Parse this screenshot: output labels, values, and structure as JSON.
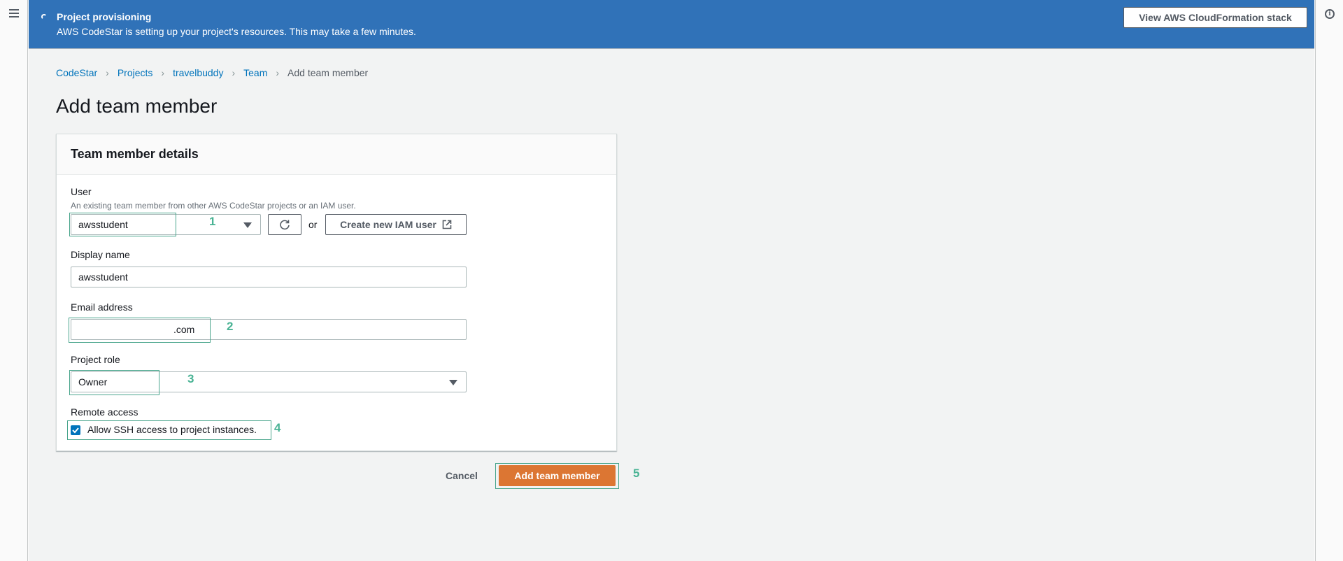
{
  "banner": {
    "title": "Project provisioning",
    "message": "AWS CodeStar is setting up your project's resources. This may take a few minutes.",
    "action_label": "View AWS CloudFormation stack",
    "color": "#3072b8"
  },
  "breadcrumb": {
    "items": [
      "CodeStar",
      "Projects",
      "travelbuddy",
      "Team"
    ],
    "current": "Add team member"
  },
  "page": {
    "title": "Add team member"
  },
  "panel": {
    "title": "Team member details",
    "user": {
      "label": "User",
      "description": "An existing team member from other AWS CodeStar projects or an IAM user.",
      "value": "awsstudent",
      "or_text": "or",
      "create_label": "Create new IAM user"
    },
    "display_name": {
      "label": "Display name",
      "value": "awsstudent"
    },
    "email": {
      "label": "Email address",
      "value": ".com"
    },
    "project_role": {
      "label": "Project role",
      "value": "Owner"
    },
    "remote_access": {
      "label": "Remote access",
      "checkbox_label": "Allow SSH access to project instances.",
      "checked": true
    }
  },
  "actions": {
    "cancel_label": "Cancel",
    "submit_label": "Add team member",
    "submit_color": "#dc7633"
  },
  "annotations": [
    "1",
    "2",
    "3",
    "4",
    "5"
  ]
}
